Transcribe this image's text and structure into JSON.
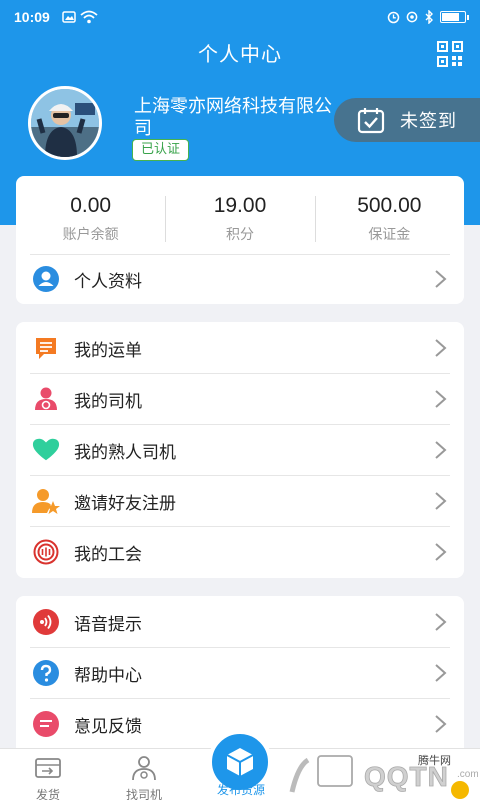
{
  "status_bar": {
    "time": "10:09",
    "battery_level": 0.7
  },
  "header": {
    "title": "个人中心"
  },
  "profile": {
    "company_name": "上海零亦网络科技有限公司",
    "certified_badge": "已认证",
    "sign_in_label": "未签到"
  },
  "stats": [
    {
      "value": "0.00",
      "label": "账户余额"
    },
    {
      "value": "19.00",
      "label": "积分"
    },
    {
      "value": "500.00",
      "label": "保证金"
    }
  ],
  "profile_row": {
    "label": "个人资料",
    "icon": "person-icon",
    "color": "#2a8de0"
  },
  "menu_group_1": [
    {
      "label": "我的运单",
      "icon": "waybill-icon",
      "color": "#f47a22"
    },
    {
      "label": "我的司机",
      "icon": "driver-icon",
      "color": "#e94b6a"
    },
    {
      "label": "我的熟人司机",
      "icon": "heart-icon",
      "color": "#2fcf9c"
    },
    {
      "label": "邀请好友注册",
      "icon": "invite-friend-icon",
      "color": "#f59a2a"
    },
    {
      "label": "我的工会",
      "icon": "union-icon",
      "color": "#d9332e"
    }
  ],
  "menu_group_2": [
    {
      "label": "语音提示",
      "icon": "voice-icon",
      "color": "#e03a3a"
    },
    {
      "label": "帮助中心",
      "icon": "help-icon",
      "color": "#2a8de0"
    },
    {
      "label": "意见反馈",
      "icon": "feedback-icon",
      "color": "#e94b6a"
    }
  ],
  "bottom_nav": {
    "ship": "发货",
    "find_driver": "找司机",
    "publish": "发布货源",
    "watermark": "腾牛网"
  },
  "colors": {
    "primary": "#1e96ea",
    "sign_bg": "#47738f",
    "certified": "#47b34f"
  }
}
